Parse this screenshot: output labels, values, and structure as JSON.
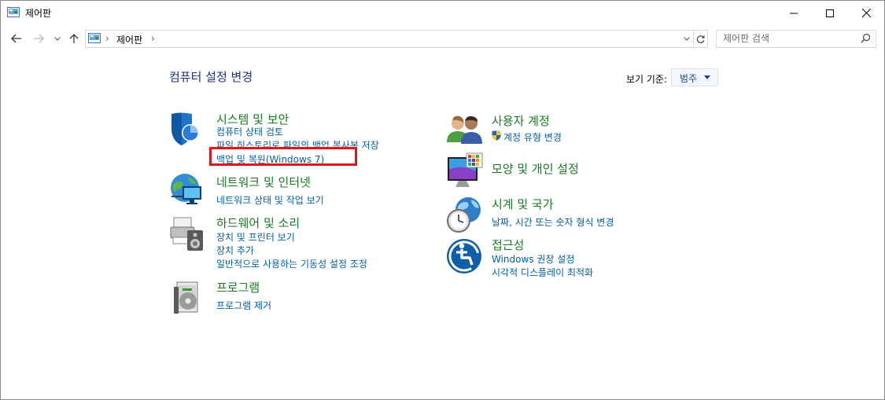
{
  "window": {
    "title": "제어판",
    "minimize_icon": "minimize-icon",
    "maximize_icon": "maximize-icon",
    "close_icon": "close-icon"
  },
  "navigation": {
    "breadcrumb": [
      "제어판"
    ],
    "search_placeholder": "제어판 검색"
  },
  "main": {
    "title": "컴퓨터 설정 변경",
    "view_by_label": "보기 기준:",
    "view_by_value": "범주"
  },
  "categories": [
    {
      "title": "시스템 및 보안",
      "icon": "shield-icon",
      "links": [
        "컴퓨터 상태 검토",
        "파일 히스토리로 파일의 백업 복사본 저장",
        "백업 및 복원(Windows 7)"
      ]
    },
    {
      "title": "네트워크 및 인터넷",
      "icon": "network-globe-icon",
      "links": [
        "네트워크 상태 및 작업 보기"
      ]
    },
    {
      "title": "하드웨어 및 소리",
      "icon": "printer-speaker-icon",
      "links": [
        "장치 및 프린터 보기",
        "장치 추가",
        "일반적으로 사용하는 기동성 설정 조정"
      ]
    },
    {
      "title": "프로그램",
      "icon": "program-disc-icon",
      "links": [
        "프로그램 제거"
      ]
    },
    {
      "title": "사용자 계정",
      "icon": "users-icon",
      "links": [
        "계정 유형 변경"
      ]
    },
    {
      "title": "모양 및 개인 설정",
      "icon": "monitor-palette-icon",
      "links": []
    },
    {
      "title": "시계 및 국가",
      "icon": "clock-globe-icon",
      "links": [
        "날짜, 시간 또는 숫자 형식 변경"
      ]
    },
    {
      "title": "접근성",
      "icon": "accessibility-icon",
      "links": [
        "Windows 권장 설정",
        "시각적 디스플레이 최적화"
      ]
    }
  ],
  "colors": {
    "heading": "#1e3287",
    "category": "#1a7a24",
    "link": "#0060a8",
    "highlight": "#e3131b"
  }
}
